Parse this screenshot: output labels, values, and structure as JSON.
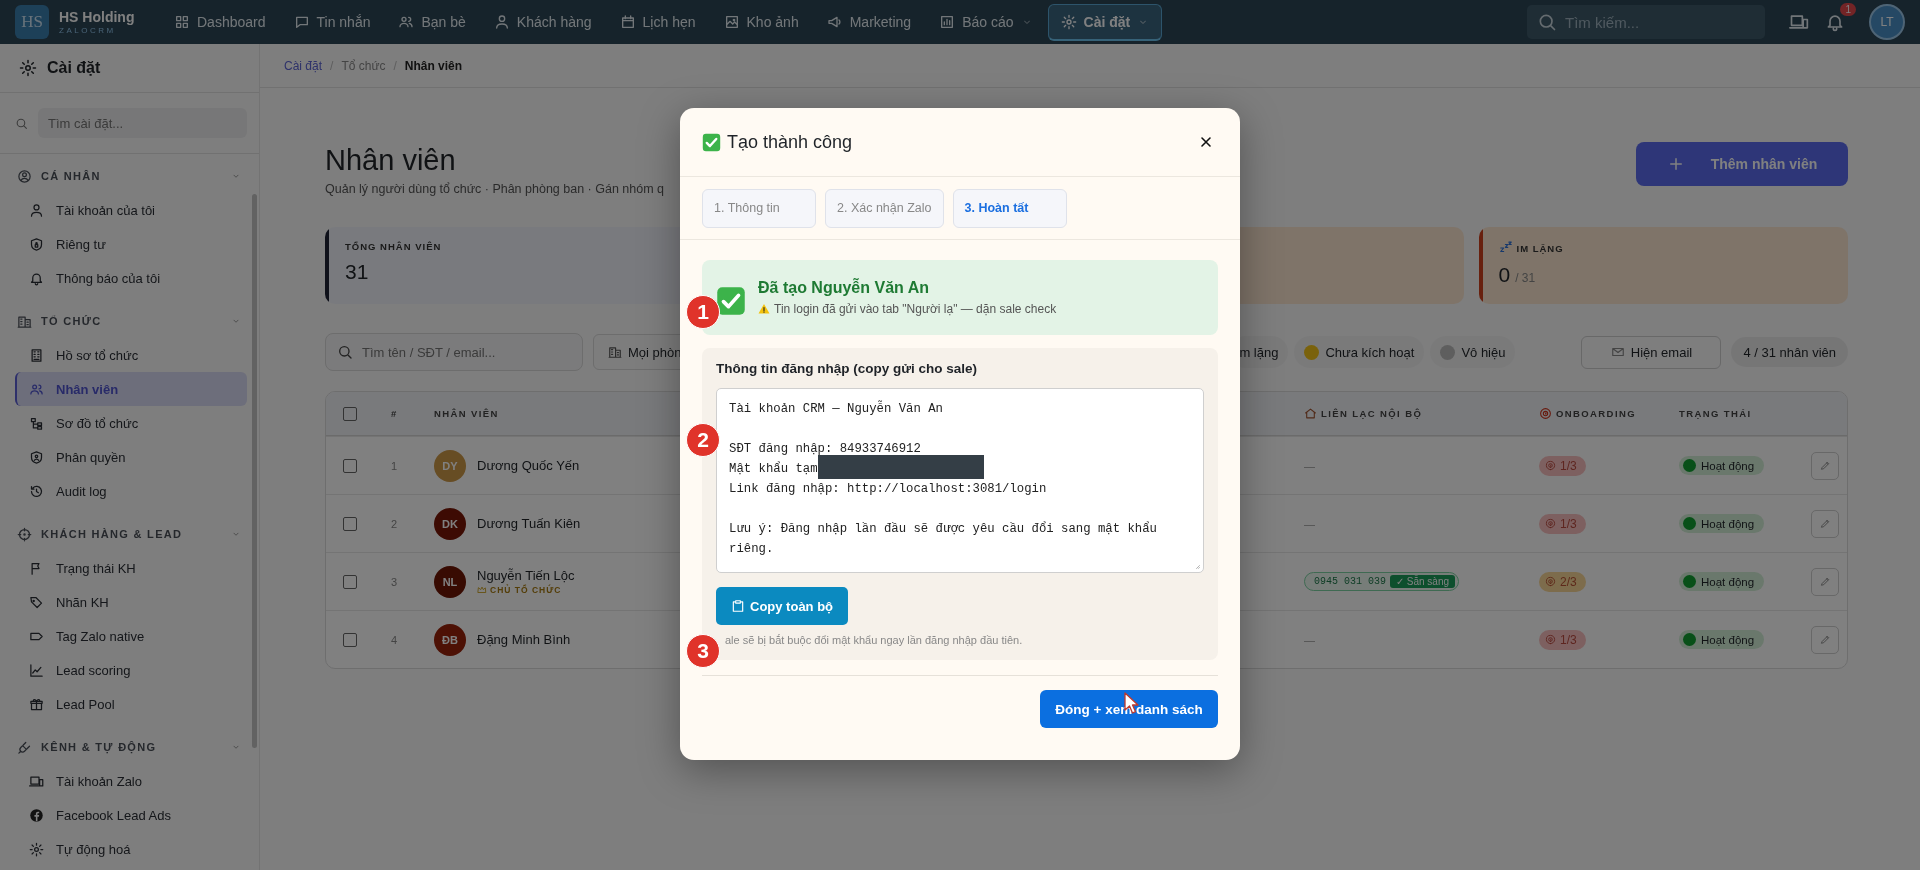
{
  "nav": {
    "logo": "HS",
    "brand": "HS Holding",
    "brand_sub": "ZALOCRM",
    "items": [
      {
        "label": "Dashboard",
        "selected": false,
        "caret": false
      },
      {
        "label": "Tin nhắn",
        "selected": false,
        "caret": false
      },
      {
        "label": "Bạn bè",
        "selected": false,
        "caret": false
      },
      {
        "label": "Khách hàng",
        "selected": false,
        "caret": false
      },
      {
        "label": "Lịch hẹn",
        "selected": false,
        "caret": false
      },
      {
        "label": "Kho ảnh",
        "selected": false,
        "caret": false
      },
      {
        "label": "Marketing",
        "selected": false,
        "caret": false
      },
      {
        "label": "Báo cáo",
        "selected": false,
        "caret": true
      },
      {
        "label": "Cài đặt",
        "selected": true,
        "caret": true
      }
    ],
    "search": {
      "placeholder": "Tìm kiếm..."
    },
    "notifications": "1",
    "avatar": "LT"
  },
  "sidebar": {
    "title": "Cài đặt",
    "search": {
      "placeholder": "Tìm cài đặt..."
    },
    "sections": [
      {
        "label": "CÁ NHÂN",
        "items": [
          {
            "label": "Tài khoản của tôi",
            "selected": false
          },
          {
            "label": "Riêng tư",
            "selected": false
          },
          {
            "label": "Thông báo của tôi",
            "selected": false
          }
        ]
      },
      {
        "label": "TỔ CHỨC",
        "items": [
          {
            "label": "Hồ sơ tổ chức",
            "selected": false
          },
          {
            "label": "Nhân viên",
            "selected": true
          },
          {
            "label": "Sơ đồ tổ chức",
            "selected": false
          },
          {
            "label": "Phân quyền",
            "selected": false
          },
          {
            "label": "Audit log",
            "selected": false
          }
        ]
      },
      {
        "label": "KHÁCH HÀNG & LEAD",
        "items": [
          {
            "label": "Trạng thái KH",
            "selected": false
          },
          {
            "label": "Nhãn KH",
            "selected": false
          },
          {
            "label": "Tag Zalo native",
            "selected": false
          },
          {
            "label": "Lead scoring",
            "selected": false
          },
          {
            "label": "Lead Pool",
            "selected": false
          }
        ]
      },
      {
        "label": "KÊNH & TỰ ĐỘNG",
        "items": [
          {
            "label": "Tài khoản Zalo",
            "selected": false
          },
          {
            "label": "Facebook Lead Ads",
            "selected": false
          },
          {
            "label": "Tự động hoá",
            "selected": false
          }
        ]
      }
    ]
  },
  "breadcrumb": {
    "separator": "/",
    "items": [
      {
        "label": "Cài đặt",
        "kind": "link"
      },
      {
        "label": "Tổ chức",
        "kind": "plain"
      },
      {
        "label": "Nhân viên",
        "kind": "current"
      }
    ]
  },
  "page": {
    "title": "Nhân viên",
    "subtitle": "Quản lý người dùng tổ chức · Phân phòng ban · Gán nhóm q",
    "add_button": "Thêm nhân viên"
  },
  "stats": [
    {
      "label": "TỔNG NHÂN VIÊN",
      "value": "31",
      "color": "#0f111a"
    },
    {
      "label": "IM LẶNG",
      "value": "0",
      "total": "/ 31",
      "color": "#68200e"
    }
  ],
  "filters": {
    "search": {
      "placeholder": "Tìm tên / SĐT / email..."
    },
    "department": "Mọi phòn",
    "chips": [
      {
        "label": "m lặng"
      },
      {
        "label": "Chưa kích hoạt",
        "color": "#7a620c"
      },
      {
        "label": "Vô hiệu",
        "color": "#5e5e5e"
      }
    ],
    "email_button": "Hiện email",
    "count": "4 / 31 nhân viên"
  },
  "table": {
    "all_checked": false,
    "columns": [
      "#",
      "NHÂN VIÊN",
      "LIÊN LẠC NỘI BỘ",
      "ONBOARDING",
      "TRẠNG THÁI"
    ],
    "rows": [
      {
        "checked": false,
        "index": "1",
        "initials": "DY",
        "color": "#674d24",
        "name": "Dương Quốc Yến",
        "contact": {
          "kind": "none",
          "text": "—"
        },
        "onboarding": {
          "text": "1/3",
          "color": "#7d6060"
        },
        "status": "Hoạt động"
      },
      {
        "checked": false,
        "index": "2",
        "initials": "DK",
        "color": "#3d0b03",
        "name": "Dương Tuấn Kiên",
        "contact": {
          "kind": "none",
          "text": "—"
        },
        "onboarding": {
          "text": "1/3",
          "color": "#7d6060"
        },
        "status": "Hoạt động"
      },
      {
        "checked": false,
        "index": "3",
        "initials": "NL",
        "color": "#380b02",
        "name": "Nguyễn Tiến Lộc",
        "role": "CHỦ TỔ CHỨC",
        "contact": {
          "kind": "phone",
          "phone": "0945 031 039",
          "badge": "✓ Sẵn sàng"
        },
        "onboarding": {
          "text": "2/3",
          "color": "#7d6c4c"
        },
        "status": "Hoạt động"
      },
      {
        "checked": false,
        "index": "4",
        "initials": "ĐB",
        "color": "#4d1105",
        "name": "Đặng Minh Bình",
        "contact": {
          "kind": "none",
          "text": "—"
        },
        "onboarding": {
          "text": "1/3",
          "color": "#7d6060"
        },
        "status": "Hoạt động"
      }
    ]
  },
  "modal": {
    "title": "Tạo thành công",
    "steps": [
      {
        "label": "1. Thông tin",
        "selected": false
      },
      {
        "label": "2. Xác nhận Zalo",
        "selected": false
      },
      {
        "label": "3. Hoàn tất",
        "selected": true
      }
    ],
    "success": {
      "title": "Đã tạo Nguyễn Văn An",
      "note": "Tin login đã gửi vào tab \"Người lạ\" — dặn sale check"
    },
    "credentials": {
      "title": "Thông tin đăng nhập (copy gửi cho sale)",
      "paragraphs": [
        {
          "lines": [
            {
              "text": "Tài khoản CRM — Nguyễn Văn An",
              "redacted": false
            }
          ]
        },
        {
          "lines": [
            {
              "text": "SĐT đăng nhập: 84933746912",
              "redacted": false
            },
            {
              "text": "Mật khẩu tạm",
              "redacted": true
            },
            {
              "text": "Link đăng nhập: http://localhost:3081/login",
              "redacted": false
            }
          ]
        },
        {
          "lines": [
            {
              "text": "Lưu ý: Đăng nhập lần đầu sẽ được yêu cầu đổi sang mật khẩu riêng.",
              "redacted": false
            }
          ]
        }
      ],
      "copy_button": "Copy toàn bộ",
      "note": "ale sẽ bị bắt buộc đổi mật khẩu ngay lần đăng nhập đầu tiên."
    },
    "close_button": "Đóng + xem danh sách"
  },
  "markers": [
    "1",
    "2",
    "3"
  ]
}
